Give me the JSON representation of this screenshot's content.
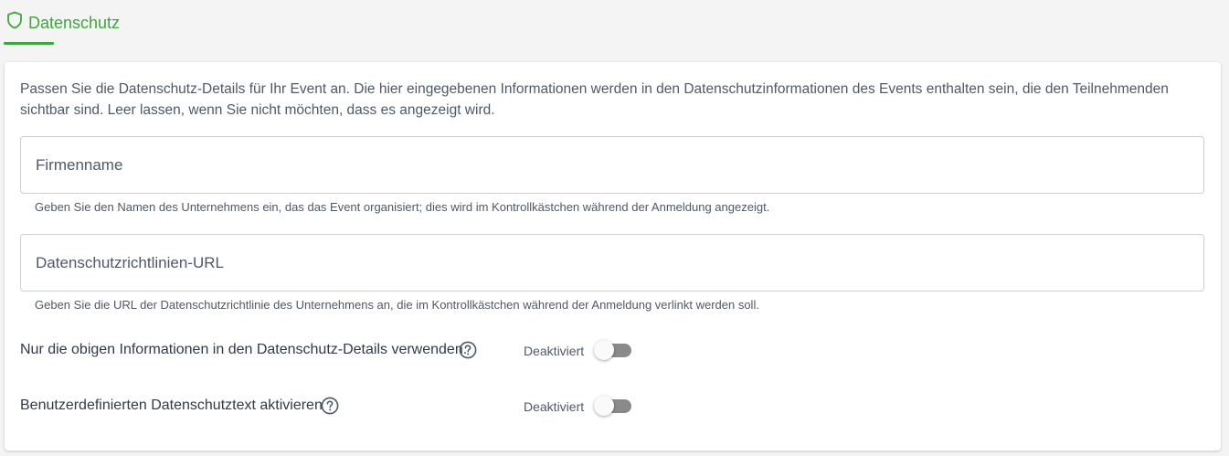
{
  "tab": {
    "label": "Datenschutz",
    "icon": "shield-icon",
    "accent_color": "#3da73e"
  },
  "intro_text": "Passen Sie die Datenschutz-Details für Ihr Event an. Die hier eingegebenen Informationen werden in den Datenschutzinformationen des Events enthalten sein, die den Teilnehmenden sichtbar sind. Leer lassen, wenn Sie nicht möchten, dass es angezeigt wird.",
  "fields": [
    {
      "placeholder": "Firmenname",
      "value": "",
      "hint": "Geben Sie den Namen des Unternehmens ein, das das Event organisiert; dies wird im Kontrollkästchen während der Anmeldung angezeigt."
    },
    {
      "placeholder": "Datenschutzrichtlinien-URL",
      "value": "",
      "hint": "Geben Sie die URL der Datenschutzrichtlinie des Unternehmens an, die im Kontrollkästchen während der Anmeldung verlinkt werden soll."
    }
  ],
  "toggles": [
    {
      "label": "Nur die obigen Informationen in den Datenschutz-Details verwenden.",
      "status": "Deaktiviert",
      "enabled": false,
      "help_icon": "help-circle-icon"
    },
    {
      "label": "Benutzerdefinierten Datenschutztext aktivieren",
      "status": "Deaktiviert",
      "enabled": false,
      "help_icon": "help-circle-icon"
    }
  ]
}
